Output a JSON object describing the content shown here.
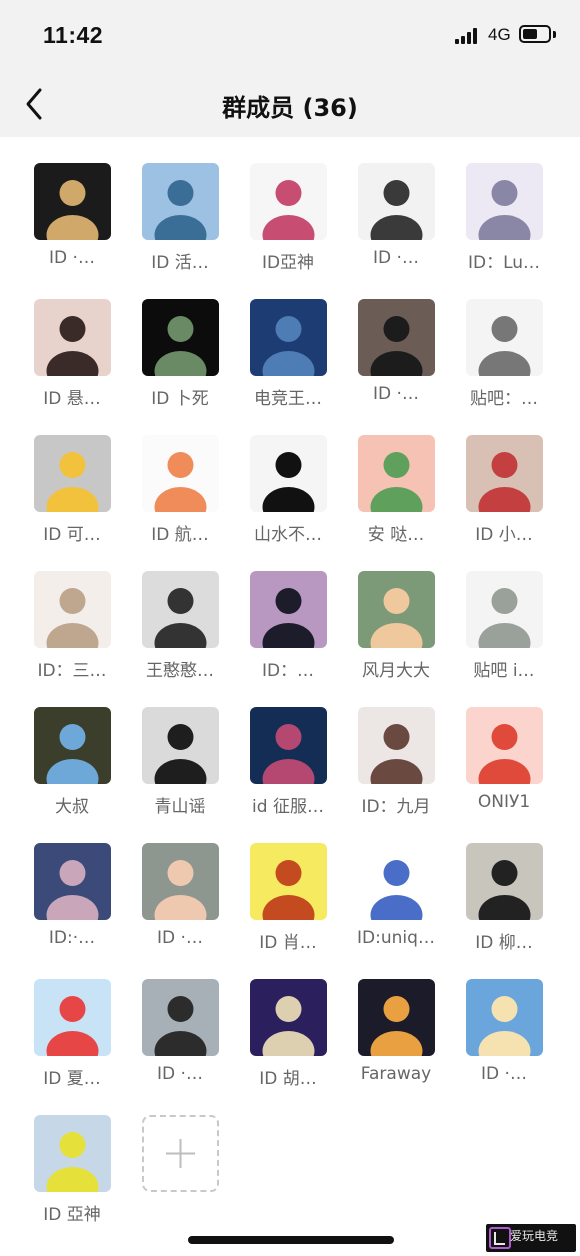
{
  "status_bar": {
    "time": "11:42",
    "network": "4G"
  },
  "header": {
    "title": "群成员 (36)",
    "back_icon": "chevron-left-icon"
  },
  "members": [
    {
      "name": "ID ·…",
      "colors": [
        "#1b1b1b",
        "#cfa86a"
      ]
    },
    {
      "name": "ID 活…",
      "colors": [
        "#9cc1e3",
        "#3a6e96"
      ]
    },
    {
      "name": "ID亞神",
      "colors": [
        "#f6f6f6",
        "#c84d73"
      ]
    },
    {
      "name": "ID ·…",
      "colors": [
        "#f2f2f2",
        "#3a3a3a"
      ]
    },
    {
      "name": "ID：Lu…",
      "colors": [
        "#ece8f4",
        "#8a87a6"
      ]
    },
    {
      "name": "ID 悬…",
      "colors": [
        "#e8d3cc",
        "#3a2a28"
      ]
    },
    {
      "name": "ID 卜死",
      "colors": [
        "#0c0c0c",
        "#6a8a66"
      ]
    },
    {
      "name": "电竞王…",
      "colors": [
        "#1d3c73",
        "#4e7cb5"
      ]
    },
    {
      "name": "ID ·…",
      "colors": [
        "#6c5c56",
        "#1c1c1c"
      ]
    },
    {
      "name": "贴吧：…",
      "colors": [
        "#f4f4f4",
        "#777777"
      ]
    },
    {
      "name": "ID 可…",
      "colors": [
        "#c7c7c7",
        "#f3c23c"
      ]
    },
    {
      "name": "ID 航…",
      "colors": [
        "#fbfbfb",
        "#f08c5a"
      ]
    },
    {
      "name": "山水不…",
      "colors": [
        "#f5f5f5",
        "#111111"
      ]
    },
    {
      "name": "安 哒…",
      "colors": [
        "#f6c2b4",
        "#5fa05c"
      ]
    },
    {
      "name": "ID 小…",
      "colors": [
        "#d8c0b4",
        "#c44040"
      ]
    },
    {
      "name": "ID：三…",
      "colors": [
        "#f4eeea",
        "#bfa68e"
      ]
    },
    {
      "name": "王憨憨…",
      "colors": [
        "#dcdcdc",
        "#333333"
      ]
    },
    {
      "name": "ID：…",
      "colors": [
        "#b897c0",
        "#1c1c2a"
      ]
    },
    {
      "name": "风月大大",
      "colors": [
        "#7d9a78",
        "#f0c89e"
      ]
    },
    {
      "name": "贴吧 i…",
      "colors": [
        "#f4f4f4",
        "#9aa09a"
      ]
    },
    {
      "name": "大叔",
      "colors": [
        "#3b3e2b",
        "#6ea8d8"
      ]
    },
    {
      "name": "青山谣",
      "colors": [
        "#dadada",
        "#1e1e1e"
      ]
    },
    {
      "name": "id 征服…",
      "colors": [
        "#142d55",
        "#b44870"
      ]
    },
    {
      "name": "ID：九月",
      "colors": [
        "#ece6e4",
        "#6a4a40"
      ]
    },
    {
      "name": "ONIУ1",
      "colors": [
        "#fbd5cd",
        "#e04a3a"
      ]
    },
    {
      "name": "ID:·…",
      "colors": [
        "#3b4a79",
        "#c9a6b9"
      ]
    },
    {
      "name": "ID ·…",
      "colors": [
        "#8e9690",
        "#efc8b0"
      ]
    },
    {
      "name": "ID 肖…",
      "colors": [
        "#f6ea60",
        "#c44a20"
      ]
    },
    {
      "name": "ID:uniq…",
      "colors": [
        "#ffffff",
        "#4a6ec8"
      ]
    },
    {
      "name": "ID 柳…",
      "colors": [
        "#c8c6bc",
        "#222222"
      ]
    },
    {
      "name": "ID 夏…",
      "colors": [
        "#c8e2f6",
        "#e64646"
      ]
    },
    {
      "name": "ID ·…",
      "colors": [
        "#a6b0b6",
        "#2c2c2c"
      ]
    },
    {
      "name": "ID 胡…",
      "colors": [
        "#2b1f5e",
        "#dcd0b0"
      ]
    },
    {
      "name": "Faraway",
      "colors": [
        "#1b1b2a",
        "#e8a040"
      ]
    },
    {
      "name": "ID ·…",
      "colors": [
        "#6aa6dc",
        "#f6e2b0"
      ]
    },
    {
      "name": "ID 亞神",
      "colors": [
        "#c6d8e8",
        "#e6e03a"
      ]
    }
  ],
  "add_member": {
    "icon": "plus-icon"
  },
  "watermark": {
    "text": "爱玩电竞"
  }
}
